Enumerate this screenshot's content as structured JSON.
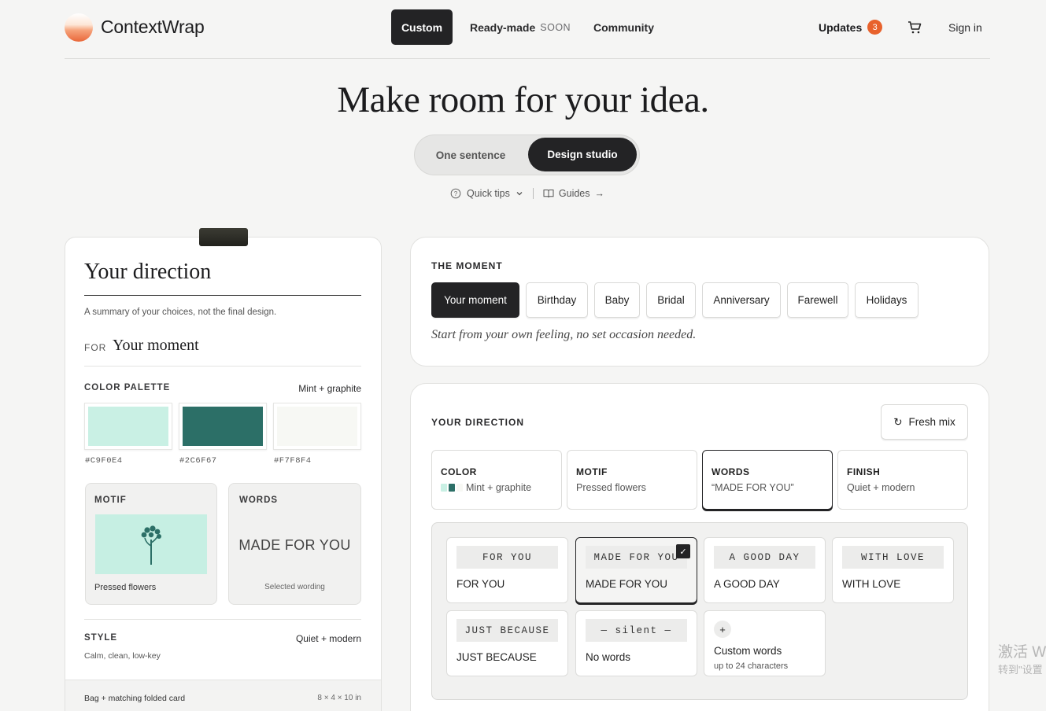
{
  "header": {
    "brand": "ContextWrap",
    "nav": {
      "custom": "Custom",
      "ready_made": "Ready-made",
      "soon": "SOON",
      "community": "Community"
    },
    "updates_label": "Updates",
    "updates_count": "3",
    "sign_in": "Sign in"
  },
  "hero": {
    "title": "Make room for your idea.",
    "toggle": {
      "one_sentence": "One sentence",
      "design_studio": "Design studio"
    },
    "quick_tips": "Quick tips",
    "guides": "Guides"
  },
  "summary": {
    "title": "Your direction",
    "subtitle": "A summary of your choices, not the final design.",
    "for_label": "FOR",
    "for_value": "Your moment",
    "palette_label": "COLOR PALETTE",
    "palette_value": "Mint + graphite",
    "swatches": [
      "#C9F0E4",
      "#2C6F67",
      "#F7F8F4"
    ],
    "motif_label": "MOTIF",
    "motif_value": "Pressed flowers",
    "words_label": "WORDS",
    "words_value": "MADE FOR YOU",
    "words_sub": "Selected wording",
    "style_label": "STYLE",
    "style_value": "Quiet + modern",
    "style_sub": "Calm, clean, low-key",
    "footer_item": "Bag + matching folded card",
    "footer_size": "8 × 4 × 10 in"
  },
  "moment": {
    "label": "THE MOMENT",
    "chips": [
      "Your moment",
      "Birthday",
      "Baby",
      "Bridal",
      "Anniversary",
      "Farewell",
      "Holidays"
    ],
    "hint": "Start from your own feeling, no set occasion needed."
  },
  "direction": {
    "label": "YOUR DIRECTION",
    "fresh_mix": "Fresh mix",
    "cards": [
      {
        "cap": "COLOR",
        "val": "Mint + graphite"
      },
      {
        "cap": "MOTIF",
        "val": "Pressed flowers"
      },
      {
        "cap": "WORDS",
        "val": "“MADE FOR YOU”"
      },
      {
        "cap": "FINISH",
        "val": "Quiet + modern"
      }
    ],
    "words": [
      {
        "tag": "FOR YOU",
        "label": "FOR YOU"
      },
      {
        "tag": "MADE FOR YOU",
        "label": "MADE FOR YOU"
      },
      {
        "tag": "A GOOD DAY",
        "label": "A GOOD DAY"
      },
      {
        "tag": "WITH LOVE",
        "label": "WITH LOVE"
      },
      {
        "tag": "JUST BECAUSE",
        "label": "JUST BECAUSE"
      },
      {
        "tag": "— silent —",
        "label": "No words"
      }
    ],
    "custom": {
      "title": "Custom words",
      "sub": "up to 24 characters"
    }
  },
  "overlay": {
    "line1": "激活 W",
    "line2": "转到\"设置"
  },
  "colors": {
    "accent": "#E8622C",
    "dark": "#232325",
    "mint": "#C9F0E4",
    "graphite": "#2C6F67",
    "paper": "#F7F8F4"
  },
  "icons": [
    "cart-icon",
    "help-circle-icon",
    "chevron-down-icon",
    "book-icon",
    "arrow-right-icon",
    "refresh-icon",
    "check-icon",
    "plus-icon",
    "flower-icon"
  ]
}
